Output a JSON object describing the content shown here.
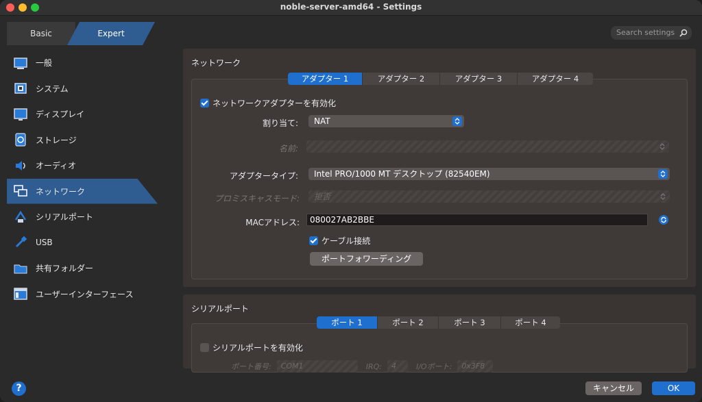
{
  "window": {
    "title": "noble-server-amd64 - Settings"
  },
  "mode": {
    "basic": "Basic",
    "expert": "Expert"
  },
  "search": {
    "placeholder": "Search settings"
  },
  "sidebar": {
    "items": [
      {
        "label": "一般",
        "icon": "general-icon"
      },
      {
        "label": "システム",
        "icon": "system-icon"
      },
      {
        "label": "ディスプレイ",
        "icon": "display-icon"
      },
      {
        "label": "ストレージ",
        "icon": "storage-icon"
      },
      {
        "label": "オーディオ",
        "icon": "audio-icon"
      },
      {
        "label": "ネットワーク",
        "icon": "network-icon"
      },
      {
        "label": "シリアルポート",
        "icon": "serial-port-icon"
      },
      {
        "label": "USB",
        "icon": "usb-icon"
      },
      {
        "label": "共有フォルダー",
        "icon": "shared-folder-icon"
      },
      {
        "label": "ユーザーインターフェース",
        "icon": "user-interface-icon"
      }
    ],
    "active": "ネットワーク"
  },
  "network": {
    "title": "ネットワーク",
    "tabs": [
      "アダプター 1",
      "アダプター 2",
      "アダプター 3",
      "アダプター 4"
    ],
    "enable_label": "ネットワークアダプターを有効化",
    "enabled": true,
    "attached_label": "割り当て:",
    "attached_value": "NAT",
    "name_label": "名前:",
    "name_value": "",
    "adapter_type_label": "アダプタータイプ:",
    "adapter_type_value": "Intel PRO/1000 MT デスクトップ (82540EM)",
    "promisc_label": "プロミスキャスモード:",
    "promisc_value": "拒否",
    "mac_label": "MACアドレス:",
    "mac_value": "080027AB2BBE",
    "cable_label": "ケーブル接続",
    "cable_connected": true,
    "port_forwarding_label": "ポートフォワーディング"
  },
  "serial": {
    "title": "シリアルポート",
    "tabs": [
      "ポート 1",
      "ポート 2",
      "ポート 3",
      "ポート 4"
    ],
    "enable_label": "シリアルポートを有効化",
    "enabled": false,
    "port_number_label": "ポート番号:",
    "port_number_value": "COM1",
    "irq_label": "IRQ:",
    "irq_value": "4",
    "io_port_label": "I/Oポート:",
    "io_port_value": "0x3F8"
  },
  "footer": {
    "help": "?",
    "cancel": "キャンセル",
    "ok": "OK"
  },
  "colors": {
    "accent": "#1f6fcf",
    "sidebar_active": "#2f5d92"
  }
}
